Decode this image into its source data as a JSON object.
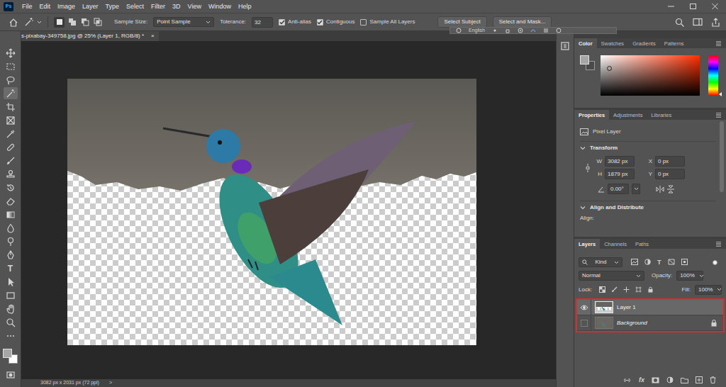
{
  "app": {
    "logo": "Ps"
  },
  "menu": [
    "File",
    "Edit",
    "Image",
    "Layer",
    "Type",
    "Select",
    "Filter",
    "3D",
    "View",
    "Window",
    "Help"
  ],
  "options_bar": {
    "modes": [
      {
        "selected": true
      },
      {
        "selected": false
      },
      {
        "selected": false
      },
      {
        "selected": false
      }
    ],
    "sample_size": {
      "label": "Sample Size:",
      "value": "Point Sample"
    },
    "tolerance": {
      "label": "Tolerance:",
      "value": "32"
    },
    "checkboxes": [
      {
        "label": "Anti-alias",
        "checked": true
      },
      {
        "label": "Contiguous",
        "checked": true
      },
      {
        "label": "Sample All Layers",
        "checked": false
      }
    ],
    "buttons": [
      "Select Subject",
      "Select and Mask..."
    ]
  },
  "ime_bar": {
    "label": "English"
  },
  "toolbar": {
    "tools": [
      {
        "selected": false
      },
      {
        "selected": false
      },
      {
        "selected": false
      },
      {
        "selected": true
      },
      {
        "selected": false
      },
      {
        "selected": false
      },
      {
        "selected": false
      },
      {
        "selected": false
      },
      {
        "selected": false
      },
      {
        "selected": false
      },
      {
        "selected": false
      },
      {
        "selected": false
      },
      {
        "selected": false
      },
      {
        "selected": false
      },
      {
        "selected": false
      },
      {
        "selected": false
      },
      {
        "selected": false,
        "glyph": "T"
      },
      {
        "selected": false
      },
      {
        "selected": false
      },
      {
        "selected": false
      },
      {
        "selected": false
      },
      {
        "selected": false
      }
    ]
  },
  "document": {
    "tab": "s-pixabay-349758.jpg @ 25% (Layer 1, RGB/8) *",
    "close": "×"
  },
  "status_bar": {
    "info": "3082 px x 2031 px (72 ppi)",
    "arrow": ">"
  },
  "color_panel": {
    "tabs": [
      {
        "label": "Color",
        "selected": true
      },
      {
        "label": "Swatches",
        "selected": false
      },
      {
        "label": "Gradients",
        "selected": false
      },
      {
        "label": "Patterns",
        "selected": false
      }
    ],
    "picker": {
      "saturation": 0.09,
      "brightness": 0.67
    },
    "hue_level": 0.97
  },
  "properties": {
    "tabs": [
      {
        "label": "Properties",
        "selected": true
      },
      {
        "label": "Adjustments",
        "selected": false
      },
      {
        "label": "Libraries",
        "selected": false
      }
    ],
    "layer_kind": "Pixel Layer",
    "transform": {
      "title": "Transform",
      "expanded": true,
      "fields": [
        {
          "label": "W",
          "value": "3082 px"
        },
        {
          "label": "X",
          "value": "0 px"
        },
        {
          "label": "H",
          "value": "1879 px"
        },
        {
          "label": "Y",
          "value": "0 px"
        }
      ],
      "angle": "0.00°"
    },
    "align": {
      "title": "Align and Distribute",
      "expanded": true,
      "label": "Align:"
    }
  },
  "layers": {
    "tabs": [
      {
        "label": "Layers",
        "selected": true
      },
      {
        "label": "Channels",
        "selected": false
      },
      {
        "label": "Paths",
        "selected": false
      }
    ],
    "filter": {
      "value": "Kind",
      "glyph": "T",
      "on": true
    },
    "blend_mode": "Normal",
    "opacity": {
      "label": "Opacity:",
      "value": "100%"
    },
    "lock_label": "Lock:",
    "fill": {
      "label": "Fill:",
      "value": "100%"
    },
    "highlighted": true,
    "items": [
      {
        "name": "Layer 1",
        "kind": "pixel",
        "visible": true,
        "selected": true,
        "locked": false
      },
      {
        "name": "Background",
        "kind": "background",
        "visible": false,
        "selected": false,
        "locked": true
      }
    ],
    "footer_glyph": "fx"
  }
}
